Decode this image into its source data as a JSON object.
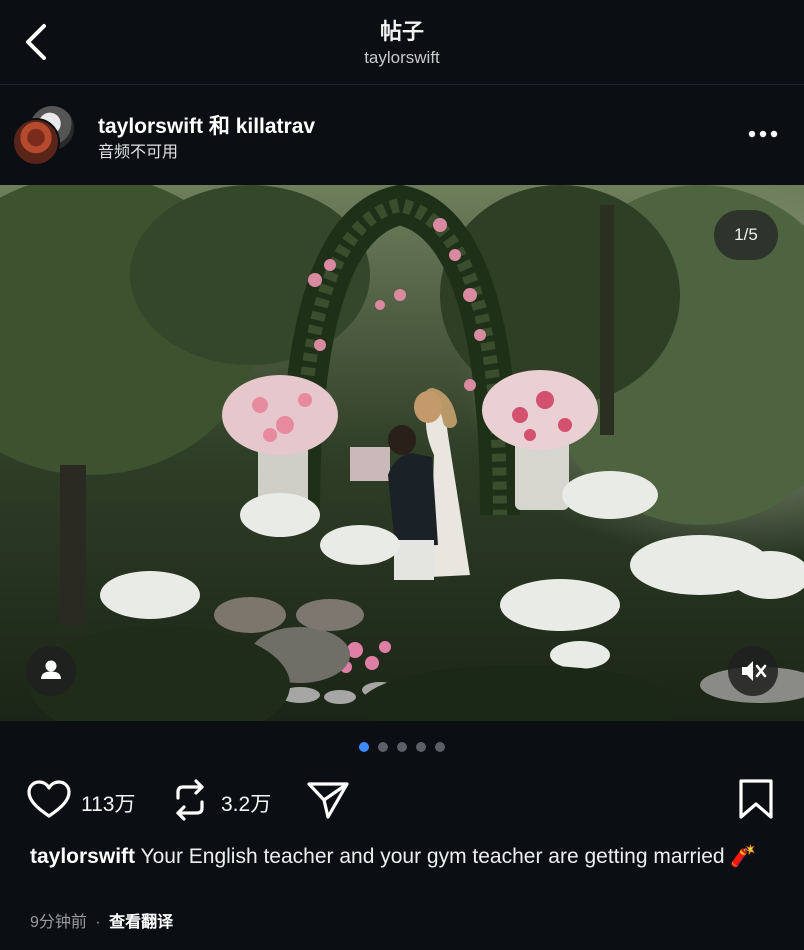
{
  "header": {
    "title": "帖子",
    "subtitle": "taylorswift"
  },
  "author": {
    "name": "taylorswift 和 killatrav",
    "subtext": "音频不可用"
  },
  "photo": {
    "counter": "1/5"
  },
  "pager": {
    "total": 5,
    "active_index": 0
  },
  "actions": {
    "likes": "113万",
    "reposts": "3.2万"
  },
  "caption": {
    "username": "taylorswift",
    "text": "Your English teacher and your gym teacher are getting married 🧨"
  },
  "meta": {
    "time": "9分钟前",
    "separator": "·",
    "translate": "查看翻译"
  },
  "colors": {
    "background": "#0b0f14",
    "active_dot": "#3d8bff",
    "inactive_dot": "#5b5f66"
  },
  "icons": [
    "back-arrow-icon",
    "more-icon",
    "user-tag-icon",
    "mute-icon",
    "heart-icon",
    "repost-icon",
    "share-icon",
    "bookmark-icon"
  ]
}
